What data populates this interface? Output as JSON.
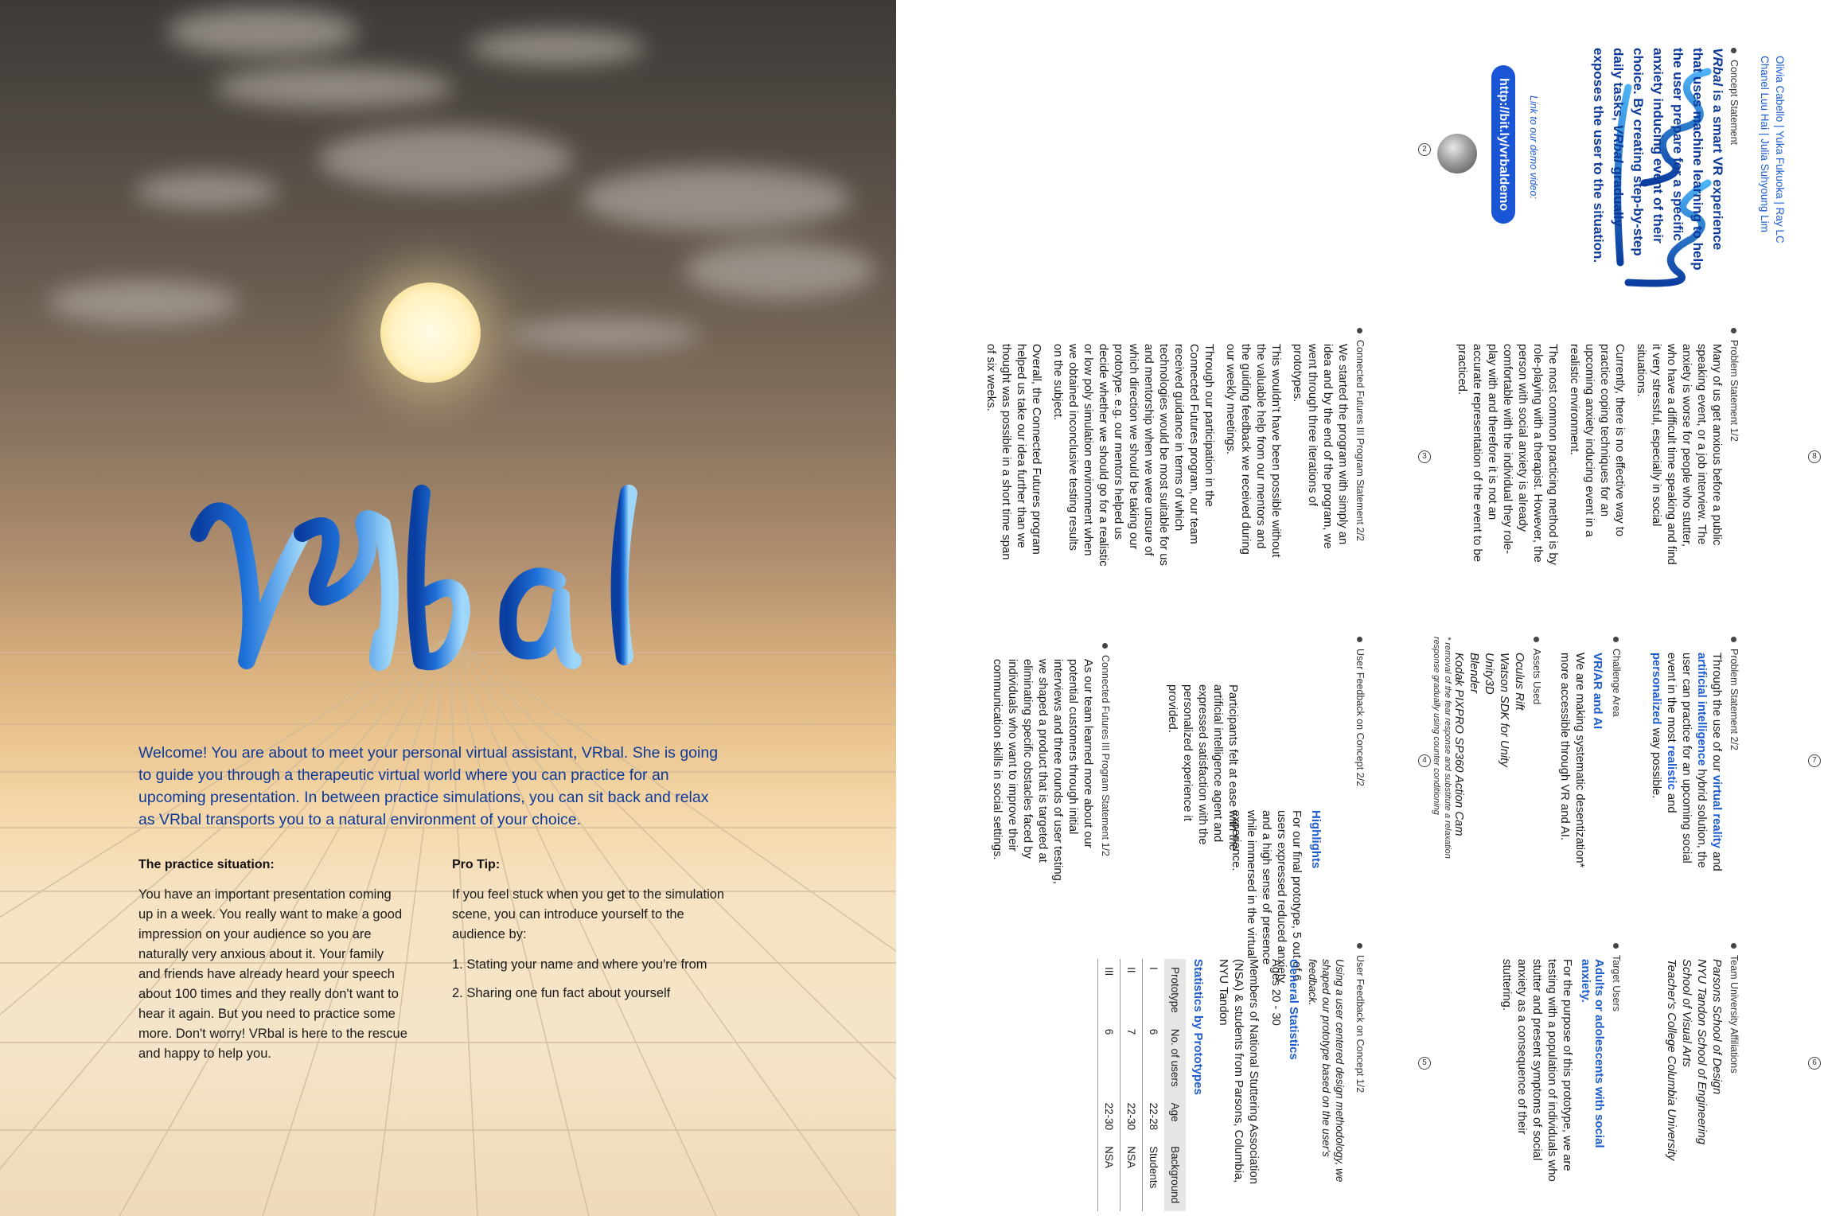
{
  "left": {
    "logo_text": "VRbal",
    "welcome": "Welcome! You are about to meet your personal virtual assistant, VRbal. She is going to guide you through a therapeutic virtual world where you can practice for an upcoming presentation. In between practice simulations, you can sit back and relax as VRbal transports you to a natural environment of your choice.",
    "practice_heading": "The practice situation:",
    "practice_body": "You have an important presentation coming up in a week. You really want to make a good impression on your audience so you are naturally very anxious about it. Your family and friends have already heard your speech about 100 times and they really don't want to hear it again. But you need to practice some more. Don't worry! VRbal is here to the rescue and happy to help you.",
    "tip_heading": "Pro Tip:",
    "tip_body": "If you feel stuck when you get to the simulation scene, you can introduce yourself to the audience by:",
    "tip_1": "1. Stating your name and where you're from",
    "tip_2": "2. Sharing one fun fact about yourself"
  },
  "right": {
    "authors_1": "Olivia Cabello | Yuka Fukuoka | Ray LC",
    "authors_2": "Chanel Luu Hai | Julia Suhyoung Lim",
    "logo_text": "VRbal",
    "concept_label": "Concept Statement",
    "concept_brand": "VRbal",
    "concept_body": "is a smart VR experience that uses machine learning to help the user prepare for a specific anxiety inducing event of their choice. By creating step-by-step daily tasks,",
    "concept_brand_2": "VRbal",
    "concept_body_2": "gradually exposes the user to the situation.",
    "demo_label": "Link to our demo video:",
    "demo_link": "http://bit.ly/vrbaldemo",
    "page_2": "2",
    "problem1_label": "Problem Statement 1/2",
    "problem1_p1": "Many of us get anxious before a public speaking event, or a job interview. The anxiety is worse for people who stutter, who have a difficult time speaking and find it very stressful, especially in social situations.",
    "problem1_p2": "Currently, there is no effective way to practice coping techniques for an upcoming anxiety inducing event in a realistic environment.",
    "problem1_p3": "The most common practicing method is by role-playing with a therapist. However, the person with social anxiety is already comfortable with the individual they role-play with and therefore it is not an accurate representation of the event to be practiced.",
    "page_3": "3",
    "problem2_label": "Problem Statement 2/2",
    "problem2_a": "Through the use of our",
    "problem2_b1": "virtual reality",
    "problem2_c": "and",
    "problem2_b2": "artificial intelligence",
    "problem2_d": "hybrid solution, the user can practice for an upcoming social event in the most",
    "problem2_b3": "realistic",
    "problem2_e": "and",
    "problem2_b4": "personalized",
    "problem2_f": "way possible.",
    "challenge_label": "Challenge Area",
    "challenge_title": "VR/AR and AI",
    "challenge_body": "We are making systematic desentization* more accessible through VR and AI.",
    "assets_label": "Assets Used",
    "assets": [
      "Oculus Rift",
      "Watson SDK for Unity",
      "Unity3D",
      "Blender",
      "Kodak PIXPRO SP360 Action Cam"
    ],
    "footnote": "* removal of the fear response and substitute a relaxation response gradually using counter conditioning",
    "page_4": "4",
    "team_label": "Team University Affiliations",
    "team": [
      "Parsons School of Design",
      "NYU Tandon School of Engineering",
      "School of Visual Arts",
      "Teacher's College Columbia University"
    ],
    "target_label": "Target Users",
    "target_title": "Adults or adolescents with social anxiety.",
    "target_body": "For the purpose of this prototype, we are testing with a population of individuals who stutter and present symptoms of social anxiety as a consequence of their stuttering.",
    "page_5": "5",
    "cf1_label": "Connected Futures III Program Statement 2/2",
    "cf1_p1": "We started the program with simply an idea and by the end of the program, we went through three iterations of prototypes.",
    "cf1_p2": "This wouldn't have been possible without the valuable help from our mentors and the guiding feedback we received during our weekly meetings.",
    "cf1_p3": "Through our participation in the Connected Futures program, our team received guidance in terms of which technologies would be most suitable for us and mentorship when we were unsure of which direction we should be taking our prototype. e.g. our mentors helped us decide whether we should go for a realistic or low poly simulation environment when we obtained inconclusive testing results on the subject.",
    "cf1_p4": "Overall, the Connected Futures program helped us take our idea further than we thought was possible in a short time span of six weeks.",
    "page_8": "8",
    "uf2_label": "User Feedback on Concept 2/2",
    "highlights": "Highlights",
    "uf2_p1": "For our final prototype, 5 out of 6 users expressed reduced anxiety and a high sense of presence while immersed in the virtual experience.",
    "uf2_p2": "Participants felt at ease with the artificial intelligence agent and expressed satisfaction with the personalized experience it provided.",
    "cf2_label": "Connected Futures III Program Statement 1/2",
    "cf2_body": "As our team learned more about our potential customers through initial interviews and three rounds of user testing, we shaped a product that is targeted at eliminating specific obstacles faced by individuals who want to improve their communication skills in social settings.",
    "page_7": "7",
    "uf1_label": "User Feedback on Concept 1/2",
    "uf1_intro": "Using a user centered design methodology, we shaped our prototype based on the user's feedback.",
    "general_stats": "General Statistics",
    "ages": "Ages 20 - 30",
    "members": "Members of National Stuttering Association (NSA) & students from Parsons, Columbia, NYU Tandon",
    "stats_title": "Statistics by Prototypes",
    "table_headers": [
      "Prototype",
      "No. of users",
      "Age",
      "Background"
    ],
    "table_rows": [
      [
        "I",
        "6",
        "22-28",
        "Students"
      ],
      [
        "II",
        "7",
        "22-30",
        "NSA"
      ],
      [
        "III",
        "6",
        "22-30",
        "NSA"
      ]
    ],
    "page_6": "6"
  },
  "colors": {
    "brand_blue": "#1c5bd0",
    "text_navy": "#0d3a9a"
  }
}
